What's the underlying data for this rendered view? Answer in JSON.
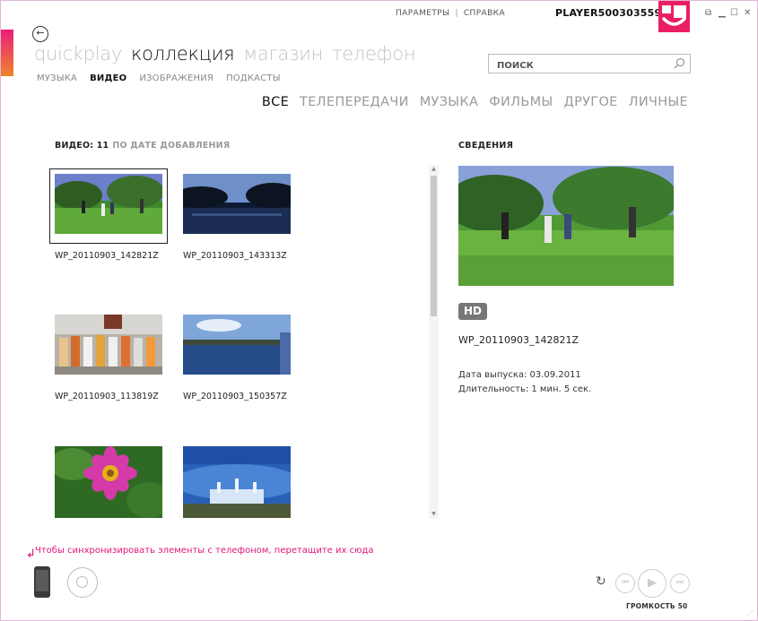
{
  "top_links": {
    "settings": "ПАРАМЕТРЫ",
    "separator": "|",
    "help": "СПРАВКА"
  },
  "user": {
    "name": "PLAYER500303559"
  },
  "pivot": [
    "quickplay",
    "коллекция",
    "магазин",
    "телефон"
  ],
  "pivot_active": 1,
  "subnav": [
    "МУЗЫКА",
    "ВИДЕО",
    "ИЗОБРАЖЕНИЯ",
    "ПОДКАСТЫ"
  ],
  "subnav_active": 1,
  "search": {
    "placeholder": "ПОИСК"
  },
  "filters": [
    "ВСЕ",
    "ТЕЛЕПЕРЕДАЧИ",
    "МУЗЫКА",
    "ФИЛЬМЫ",
    "ДРУГОЕ",
    "ЛИЧНЫЕ"
  ],
  "filters_active": 0,
  "list": {
    "count_label": "ВИДЕО: 11",
    "sort_label": "ПО ДАТЕ ДОБАВЛЕНИЯ",
    "items": [
      {
        "name": "WP_20110903_142821Z",
        "thumb": "park-people-grass"
      },
      {
        "name": "WP_20110903_143313Z",
        "thumb": "lake-dusk-trees"
      },
      {
        "name": "WP_20110903_113819Z",
        "thumb": "street-festival-crowd"
      },
      {
        "name": "WP_20110903_150357Z",
        "thumb": "river-city-blue-sky"
      },
      {
        "name": "",
        "thumb": "pink-flower"
      },
      {
        "name": "",
        "thumb": "fountain-blue-sky"
      }
    ]
  },
  "details": {
    "title": "СВЕДЕНИЯ",
    "badge": "HD",
    "name": "WP_20110903_142821Z",
    "release_date": "Дата выпуска: 03.09.2011",
    "duration": "Длительность: 1 мин. 5 сек."
  },
  "sync_hint": "Чтобы синхронизировать элементы с телефоном, перетащите их сюда",
  "player": {
    "volume_label": "ГРОМКОСТЬ 50"
  },
  "colors": {
    "accent": "#ea1f63",
    "sync_text": "#e0157b"
  }
}
